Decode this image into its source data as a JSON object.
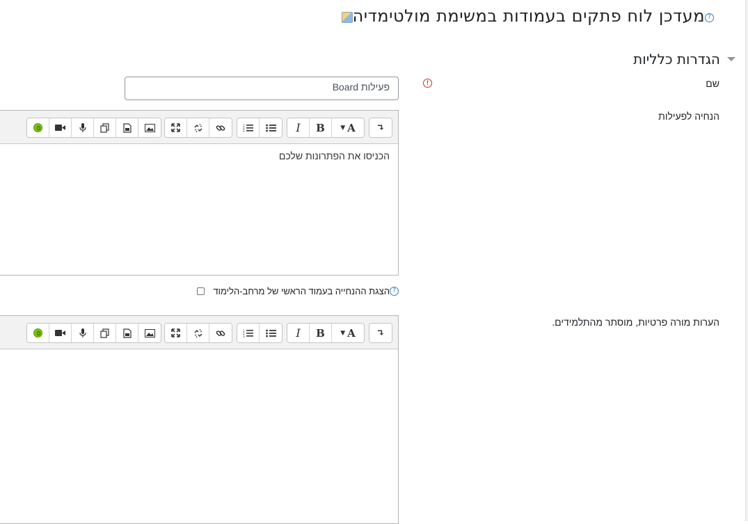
{
  "page": {
    "title": "מעדכן לוח פתקים בעמודות במשימת מולטימדיה",
    "title_icon": "activity-board-icon",
    "help_icon": "help-icon"
  },
  "section": {
    "title": "הגדרות כלליות"
  },
  "form": {
    "name_label": "שם",
    "name_value": "פעילות Board",
    "intro_label": "הנחיה לפעילות",
    "intro_text": "הכניסו את הפתרונות שלכם",
    "show_description_label": "הצגת ההנחייה בעמוד הראשי של מרחב-הלימוד",
    "teacher_notes_label": "הערות מורה פרטיות, מוסתר מהתלמידים."
  },
  "toolbar": {
    "buttons": [
      {
        "name": "toggle-toolbar-icon",
        "glyph": "↴"
      },
      {
        "name": "font-style-icon",
        "glyph": "▾A"
      },
      {
        "name": "bold-icon",
        "glyph": "B"
      },
      {
        "name": "italic-icon",
        "glyph": "I"
      },
      {
        "name": "unordered-list-icon",
        "glyph": "☰"
      },
      {
        "name": "ordered-list-icon",
        "glyph": "≡"
      },
      {
        "name": "link-icon",
        "glyph": "⚭"
      },
      {
        "name": "unlink-icon",
        "glyph": "⚯"
      },
      {
        "name": "fullscreen-icon",
        "glyph": "⤧"
      },
      {
        "name": "image-icon",
        "glyph": "▣"
      },
      {
        "name": "media-icon",
        "glyph": "▤"
      },
      {
        "name": "manage-files-icon",
        "glyph": "⧉"
      },
      {
        "name": "record-audio-icon",
        "glyph": "🎙"
      },
      {
        "name": "record-video-icon",
        "glyph": "■"
      },
      {
        "name": "h5p-icon",
        "glyph": ""
      }
    ]
  },
  "colors": {
    "accent": "#3b7fb8",
    "required": "#ca3120",
    "toolbar_bg": "#f2f2f2"
  }
}
